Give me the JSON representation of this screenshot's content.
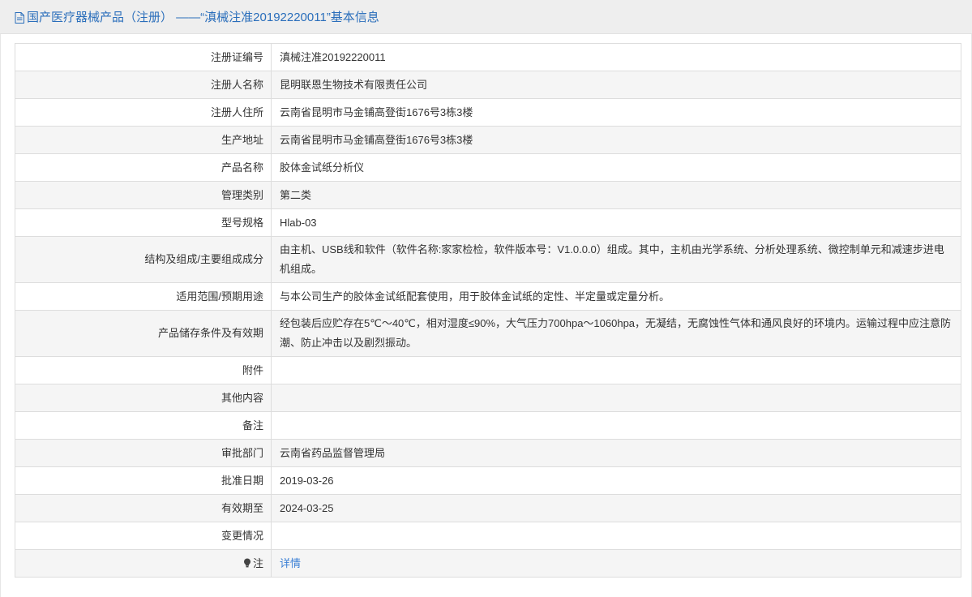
{
  "header": {
    "title": "国产医疗器械产品（注册） ——“滇械注准20192220011”基本信息",
    "icon": "document-icon",
    "color": "#2a6ebb"
  },
  "rows": [
    {
      "label": "注册证编号",
      "value": "滇械注准20192220011"
    },
    {
      "label": "注册人名称",
      "value": "昆明联恩生物技术有限责任公司"
    },
    {
      "label": "注册人住所",
      "value": "云南省昆明市马金铺高登街1676号3栋3楼"
    },
    {
      "label": "生产地址",
      "value": "云南省昆明市马金铺高登街1676号3栋3楼"
    },
    {
      "label": "产品名称",
      "value": "胶体金试纸分析仪"
    },
    {
      "label": "管理类别",
      "value": "第二类"
    },
    {
      "label": "型号规格",
      "value": "Hlab-03"
    },
    {
      "label": "结构及组成/主要组成成分",
      "value": "由主机、USB线和软件（软件名称:家家检检，软件版本号：V1.0.0.0）组成。其中，主机由光学系统、分析处理系统、微控制单元和减速步进电机组成。"
    },
    {
      "label": "适用范围/预期用途",
      "value": "与本公司生产的胶体金试纸配套使用，用于胶体金试纸的定性、半定量或定量分析。"
    },
    {
      "label": "产品储存条件及有效期",
      "value": "经包装后应贮存在5℃～40℃，相对湿度≤90%，大气压力700hpa～1060hpa，无凝结，无腐蚀性气体和通风良好的环境内。运输过程中应注意防潮、防止冲击以及剧烈振动。"
    },
    {
      "label": "附件",
      "value": ""
    },
    {
      "label": "其他内容",
      "value": ""
    },
    {
      "label": "备注",
      "value": ""
    },
    {
      "label": "审批部门",
      "value": "云南省药品监督管理局"
    },
    {
      "label": "批准日期",
      "value": "2019-03-26"
    },
    {
      "label": "有效期至",
      "value": "2024-03-25"
    },
    {
      "label": "变更情况",
      "value": ""
    }
  ],
  "note_row": {
    "label": "注",
    "icon": "lightbulb-icon",
    "link_text": "详情",
    "link_color": "#3a7fd5"
  }
}
